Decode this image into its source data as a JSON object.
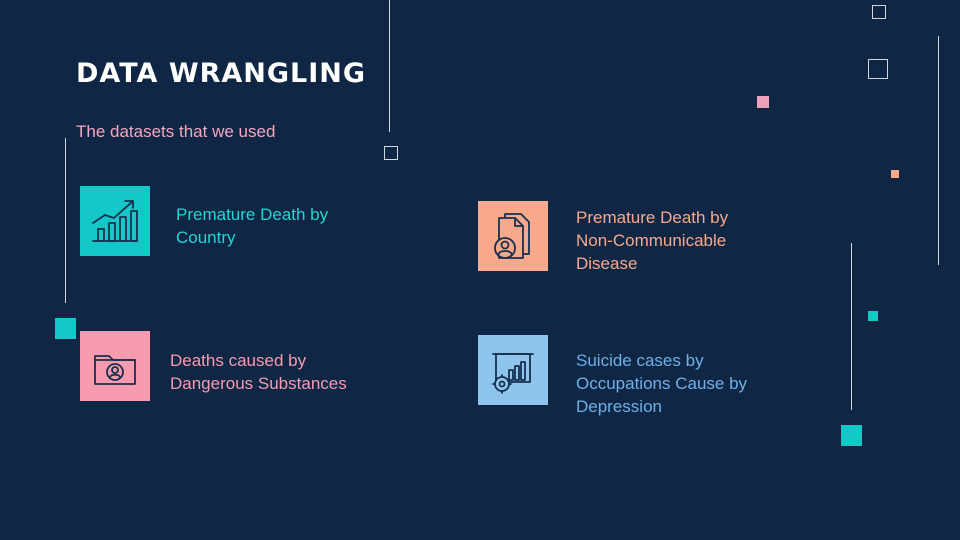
{
  "slide": {
    "title": "DATA WRANGLING",
    "subtitle": "The datasets that we used"
  },
  "datasets": [
    {
      "line1": "Premature Death by",
      "line2": "Country",
      "line3": "",
      "icon": "growth-chart-icon",
      "color": "#15c8c8",
      "text_color": "#1fd6d3"
    },
    {
      "line1": "Premature Death by",
      "line2": "Non-Communicable",
      "line3": "Disease",
      "icon": "patient-document-icon",
      "color": "#f9a98b",
      "text_color": "#f9a98b"
    },
    {
      "line1": "Deaths caused by",
      "line2": "Dangerous Substances",
      "line3": "",
      "icon": "patient-folder-icon",
      "color": "#f79bb0",
      "text_color": "#f79bb0"
    },
    {
      "line1": "Suicide cases by",
      "line2": "Occupations Cause by",
      "line3": "Depression",
      "icon": "presentation-gear-icon",
      "color": "#8fc4ec",
      "text_color": "#6fb0e8"
    }
  ]
}
